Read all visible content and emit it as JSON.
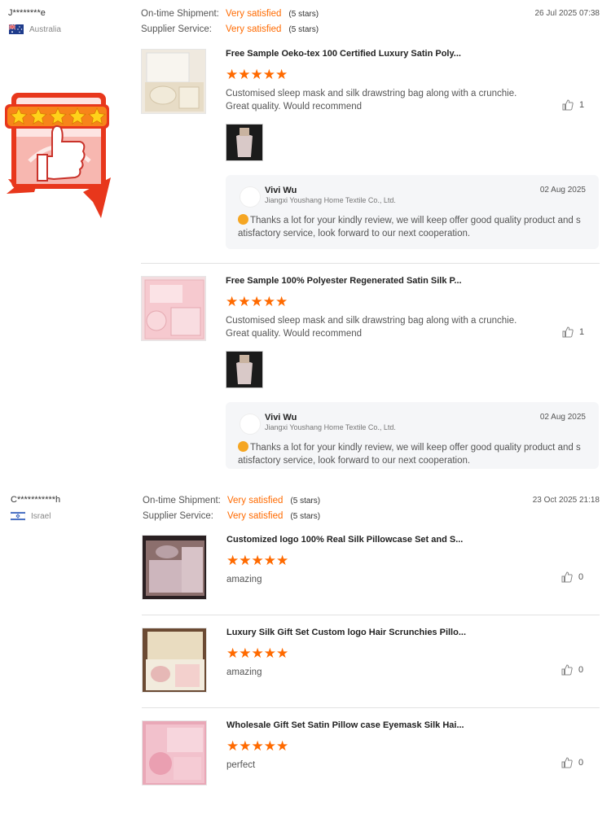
{
  "reviews": [
    {
      "buyer": "J********e",
      "country": "Australia",
      "shipment_label": "On-time Shipment:",
      "shipment_value": "Very satisfied",
      "shipment_stars": "(5 stars)",
      "service_label": "Supplier Service:",
      "service_value": "Very satisfied",
      "service_stars": "(5 stars)",
      "date": "26 Jul 2025 07:38",
      "items": [
        {
          "title": "Free Sample Oeko-tex 100 Certified Luxury Satin Poly...",
          "rating": 5,
          "comment": "Customised sleep mask and silk drawstring bag along with a crunchie. Great quality. Would recommend",
          "likes": "1",
          "reply": {
            "name": "Vivi Wu",
            "company": "Jiangxi Youshang Home Textile Co., Ltd.",
            "date": "02 Aug 2025",
            "text": "Thanks a lot for your kindly review, we will keep offer good quality product and satisfactory service, look forward to our next cooperation."
          }
        },
        {
          "title": "Free Sample 100% Polyester Regenerated Satin Silk P...",
          "rating": 5,
          "comment": "Customised sleep mask and silk drawstring bag along with a crunchie. Great quality. Would recommend",
          "likes": "1",
          "reply": {
            "name": "Vivi Wu",
            "company": "Jiangxi Youshang Home Textile Co., Ltd.",
            "date": "02 Aug 2025",
            "text": "Thanks a lot for your kindly review, we will keep offer good quality product and satisfactory service, look forward to our next cooperation."
          }
        }
      ]
    },
    {
      "buyer": "C***********h",
      "country": "Israel",
      "shipment_label": "On-time Shipment:",
      "shipment_value": "Very satisfied",
      "shipment_stars": "(5 stars)",
      "service_label": "Supplier Service:",
      "service_value": "Very satisfied",
      "service_stars": "(5 stars)",
      "date": "23 Oct 2025 21:18",
      "items": [
        {
          "title": "Customized logo 100% Real Silk Pillowcase Set and S...",
          "rating": 5,
          "comment": "amazing",
          "likes": "0"
        },
        {
          "title": "Luxury Silk Gift Set Custom logo Hair Scrunchies Pillo...",
          "rating": 5,
          "comment": "amazing",
          "likes": "0"
        },
        {
          "title": "Wholesale Gift Set Satin Pillow case Eyemask Silk Hai...",
          "rating": 5,
          "comment": "perfect",
          "likes": "0"
        }
      ]
    }
  ],
  "colors": {
    "accent": "#ff6a00",
    "divider": "#e2e2e2",
    "reply_bg": "#f5f6f8"
  }
}
